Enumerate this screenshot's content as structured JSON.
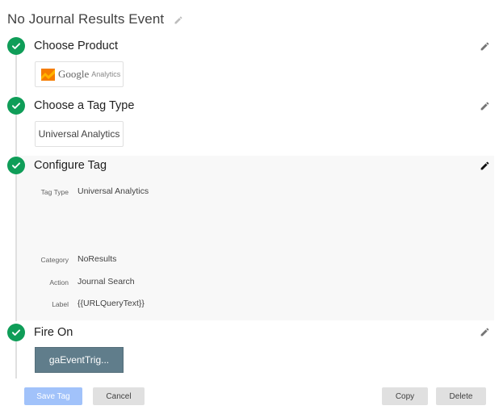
{
  "header": {
    "title": "No Journal Results Event",
    "edit_icon": "pencil-icon"
  },
  "steps": [
    {
      "title": "Choose Product",
      "status": "complete",
      "product": {
        "logo_icon": "google-analytics-logo-icon",
        "brand": "Google",
        "name": "Analytics"
      }
    },
    {
      "title": "Choose a Tag Type",
      "status": "complete",
      "tag_type": "Universal Analytics"
    },
    {
      "title": "Configure Tag",
      "status": "complete",
      "active": true,
      "fields": [
        {
          "label": "Tag Type",
          "value": "Universal Analytics"
        },
        {
          "label": "Category",
          "value": "NoResults"
        },
        {
          "label": "Action",
          "value": "Journal Search"
        },
        {
          "label": "Label",
          "value": "{{URLQueryText}}"
        }
      ]
    },
    {
      "title": "Fire On",
      "status": "complete",
      "trigger": "gaEventTrig..."
    }
  ],
  "actions": {
    "save_label": "Save Tag",
    "cancel_label": "Cancel",
    "copy_label": "Copy",
    "delete_label": "Delete"
  },
  "colors": {
    "check_green": "#0f9d58",
    "trigger_chip": "#607d8b",
    "save_disabled": "#a1c2fa",
    "panel_bg": "#f8f8f8"
  }
}
